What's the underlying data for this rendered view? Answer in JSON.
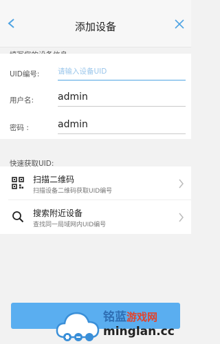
{
  "header": {
    "title": "添加设备"
  },
  "form": {
    "section_label": "填写您的设备信息",
    "uid": {
      "label": "UID编号:",
      "value": "",
      "placeholder": "请输入设备UID"
    },
    "username": {
      "label": "用户名:",
      "value": "admin"
    },
    "password": {
      "label": "密码 :",
      "value": "admin"
    }
  },
  "quick": {
    "section_label": "快速获取UID:",
    "items": [
      {
        "name": "扫描二维码",
        "desc": "扫描设备二维码获取UID编号",
        "icon": "qr-code-icon"
      },
      {
        "name": "搜索附近设备",
        "desc": "查找同一局域网内UID编号",
        "icon": "search-icon"
      }
    ]
  },
  "watermark": {
    "brand": "铭蓝",
    "game": "游戏网",
    "url": "minglan.cc"
  },
  "colors": {
    "accent": "#4ea3e3",
    "button": "#5aaef0",
    "background": "#f2f2f2"
  }
}
